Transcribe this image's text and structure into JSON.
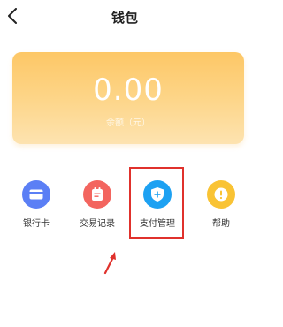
{
  "header": {
    "title": "钱包",
    "back_icon": "chevron-left-icon"
  },
  "wallet": {
    "balance": "0.00",
    "balance_label": "余额（元）"
  },
  "menu": [
    {
      "label": "银行卡",
      "icon": "bank-card-icon",
      "color": "#5b7ff5"
    },
    {
      "label": "交易记录",
      "icon": "transaction-record-icon",
      "color": "#f3655f"
    },
    {
      "label": "支付管理",
      "icon": "shield-plus-icon",
      "color": "#1da1f2"
    },
    {
      "label": "帮助",
      "icon": "info-circle-icon",
      "color": "#f9c334"
    }
  ],
  "annotation": {
    "highlight_color": "#e0312c"
  }
}
